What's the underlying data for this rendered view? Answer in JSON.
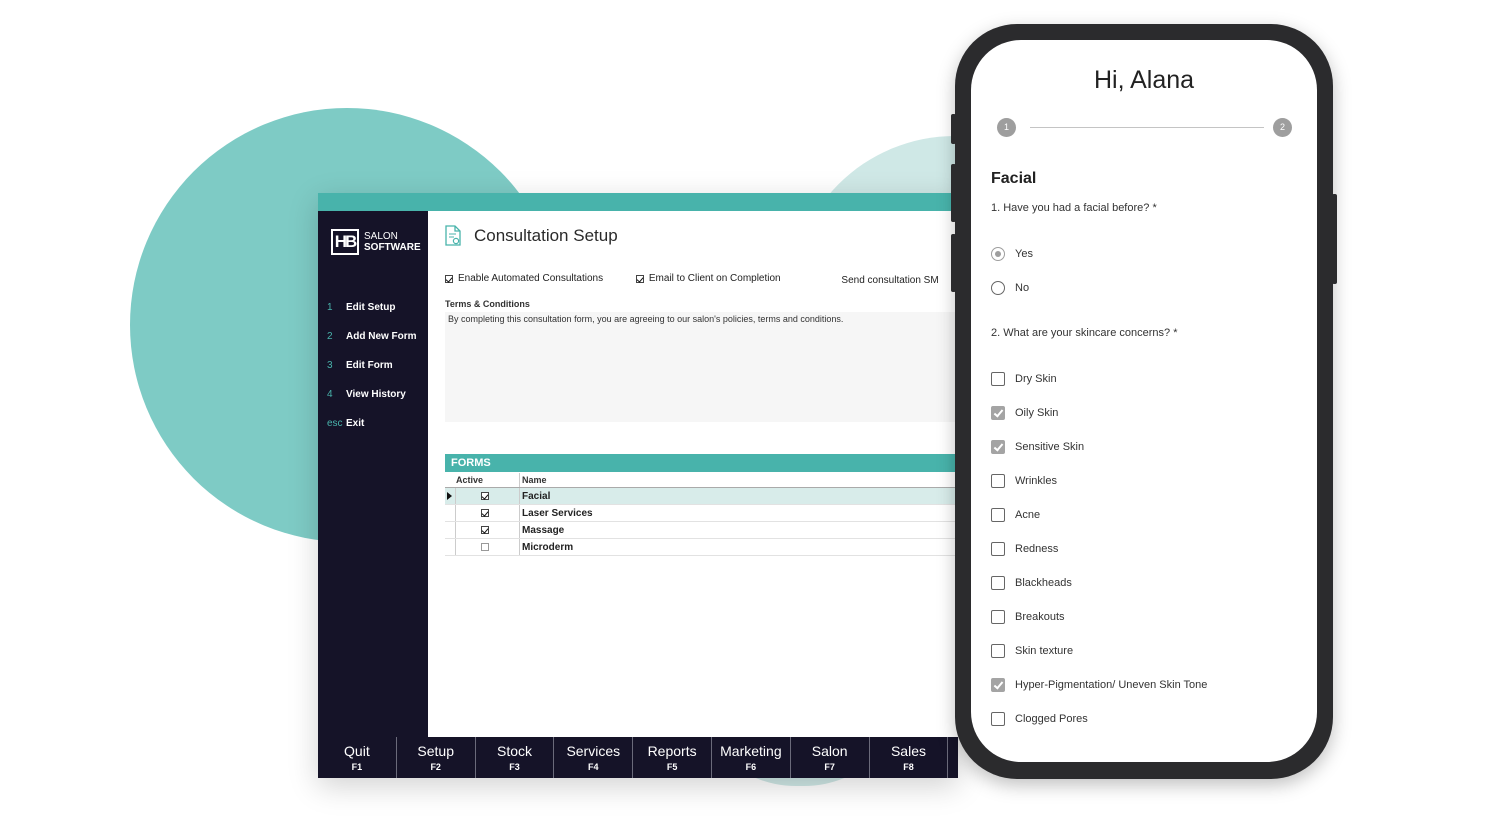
{
  "app": {
    "logo": {
      "line1": "SALON",
      "line2": "SOFTWARE"
    },
    "title": "Consultation Setup",
    "nav": [
      {
        "key": "1",
        "label": "Edit Setup"
      },
      {
        "key": "2",
        "label": "Add New Form"
      },
      {
        "key": "3",
        "label": "Edit Form"
      },
      {
        "key": "4",
        "label": "View History"
      },
      {
        "key": "esc",
        "label": "Exit"
      }
    ],
    "options": {
      "enable_auto": {
        "label": "Enable Automated Consultations",
        "checked": true
      },
      "email_client": {
        "label": "Email to Client on Completion",
        "checked": true
      },
      "sms_label": "Send consultation SM"
    },
    "terms": {
      "label": "Terms & Conditions",
      "text": "By completing this consultation form, you are agreeing to our salon's policies, terms and conditions."
    },
    "forms": {
      "header": "FORMS",
      "columns": {
        "active": "Active",
        "name": "Name"
      },
      "rows": [
        {
          "active": true,
          "name": "Facial",
          "selected": true
        },
        {
          "active": true,
          "name": "Laser Services",
          "selected": false
        },
        {
          "active": true,
          "name": "Massage",
          "selected": false
        },
        {
          "active": false,
          "name": "Microderm",
          "selected": false
        }
      ]
    },
    "fkeys": [
      {
        "label": "Quit",
        "key": "F1"
      },
      {
        "label": "Setup",
        "key": "F2"
      },
      {
        "label": "Stock",
        "key": "F3"
      },
      {
        "label": "Services",
        "key": "F4"
      },
      {
        "label": "Reports",
        "key": "F5"
      },
      {
        "label": "Marketing",
        "key": "F6"
      },
      {
        "label": "Salon",
        "key": "F7"
      },
      {
        "label": "Sales",
        "key": "F8"
      }
    ]
  },
  "phone": {
    "greeting": "Hi, Alana",
    "steps": [
      "1",
      "2"
    ],
    "section": "Facial",
    "q1": {
      "text": "1. Have you had a facial before? *",
      "options": [
        {
          "label": "Yes",
          "selected": true
        },
        {
          "label": "No",
          "selected": false
        }
      ]
    },
    "q2": {
      "text": "2. What are your skincare concerns? *",
      "options": [
        {
          "label": "Dry Skin",
          "checked": false
        },
        {
          "label": "Oily Skin",
          "checked": true
        },
        {
          "label": "Sensitive Skin",
          "checked": true
        },
        {
          "label": "Wrinkles",
          "checked": false
        },
        {
          "label": "Acne",
          "checked": false
        },
        {
          "label": "Redness",
          "checked": false
        },
        {
          "label": "Blackheads",
          "checked": false
        },
        {
          "label": "Breakouts",
          "checked": false
        },
        {
          "label": "Skin texture",
          "checked": false
        },
        {
          "label": "Hyper-Pigmentation/ Uneven Skin Tone",
          "checked": true
        },
        {
          "label": "Clogged Pores",
          "checked": false
        }
      ]
    }
  },
  "colors": {
    "accent": "#48b3ab",
    "sidebar": "#151328",
    "circle": "#7ecbc5",
    "phone_frame": "#2b2b2d"
  }
}
